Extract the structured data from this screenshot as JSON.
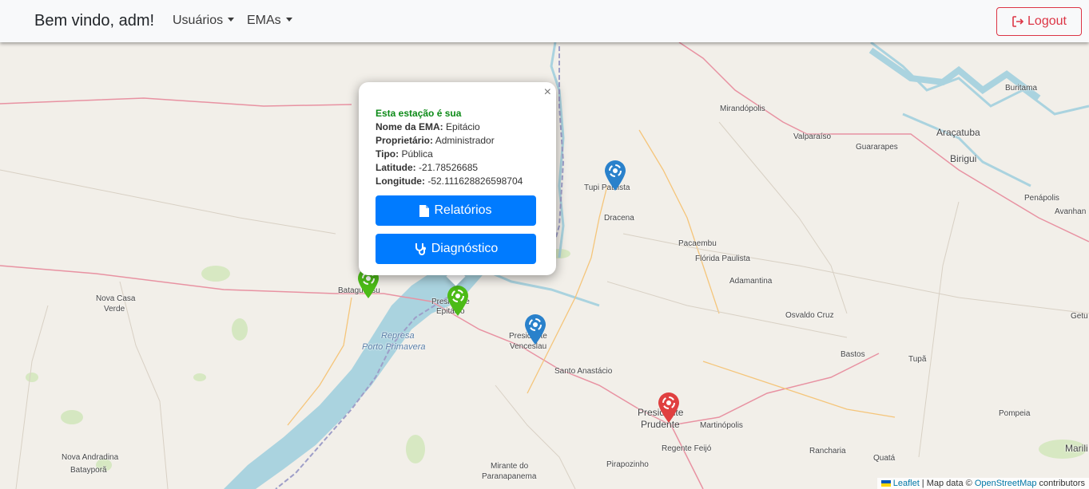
{
  "navbar": {
    "brand": "Bem vindo, adm!",
    "menu_users": "Usuários",
    "menu_emas": "EMAs",
    "logout_label": "Logout"
  },
  "popup": {
    "ownership": "Esta estação é sua",
    "name_label": "Nome da EMA:",
    "name_value": " Epitácio",
    "owner_label": "Proprietário:",
    "owner_value": " Administrador",
    "type_label": "Tipo:",
    "type_value": " Pública",
    "lat_label": "Latitude:",
    "lat_value": " -21.78526685",
    "lon_label": "Longitude:",
    "lon_value": " -52.111628826598704",
    "reports_button": "Relatórios",
    "diagnostic_button": "Diagnóstico",
    "close": "×"
  },
  "places": {
    "mirandopolis": "Mirandópolis",
    "buritama": "Buritama",
    "aracatuba": "Araçatuba",
    "valparaiso": "Valparaíso",
    "guararapes": "Guararapes",
    "birigui": "Birigui",
    "tupi": "Tupi Paulista",
    "dracena": "Dracena",
    "penapolis": "Penápolis",
    "avanhandava": "Avanhan",
    "pacaembu": "Pacaembu",
    "florida": "Flórida Paulista",
    "adamantina": "Adamantina",
    "bataguassu": "Bataguassu",
    "nova_casa_verde_1": "Nova Casa",
    "nova_casa_verde_2": "Verde",
    "presidente_epitacio_1": "Presidente",
    "presidente_epitacio_2": "Epitácio",
    "presidente_venceslau_1": "Presidente",
    "presidente_venceslau_2": "Venceslau",
    "osvaldo_cruz": "Osvaldo Cruz",
    "getulina": "Getu",
    "represa_1": "Represa",
    "represa_2": "Porto Primavera",
    "bastos": "Bastos",
    "tupa": "Tupã",
    "santo_anastacio": "Santo Anastácio",
    "presidente_prudente_1": "Presidente",
    "presidente_prudente_2": "Prudente",
    "martinopolis": "Martinópolis",
    "pompeia": "Pompeia",
    "nova_andradina": "Nova Andradina",
    "batayporã": "Batayporã",
    "regente_feijo": "Regente Feijó",
    "rancharia": "Rancharia",
    "quata": "Quatá",
    "marilia": "Marili",
    "mirante_1": "Mirante do",
    "mirante_2": "Paranapanema",
    "pirapozinho": "Pirapozinho"
  },
  "attribution": {
    "leaflet": "Leaflet",
    "sep": " | Map data © ",
    "osm": "OpenStreetMap",
    "contrib": " contributors"
  },
  "colors": {
    "marker_own": "#4cbb17",
    "marker_public": "#2a81cb",
    "marker_other": "#e04040",
    "primary": "#007bff",
    "danger": "#dc3545"
  }
}
